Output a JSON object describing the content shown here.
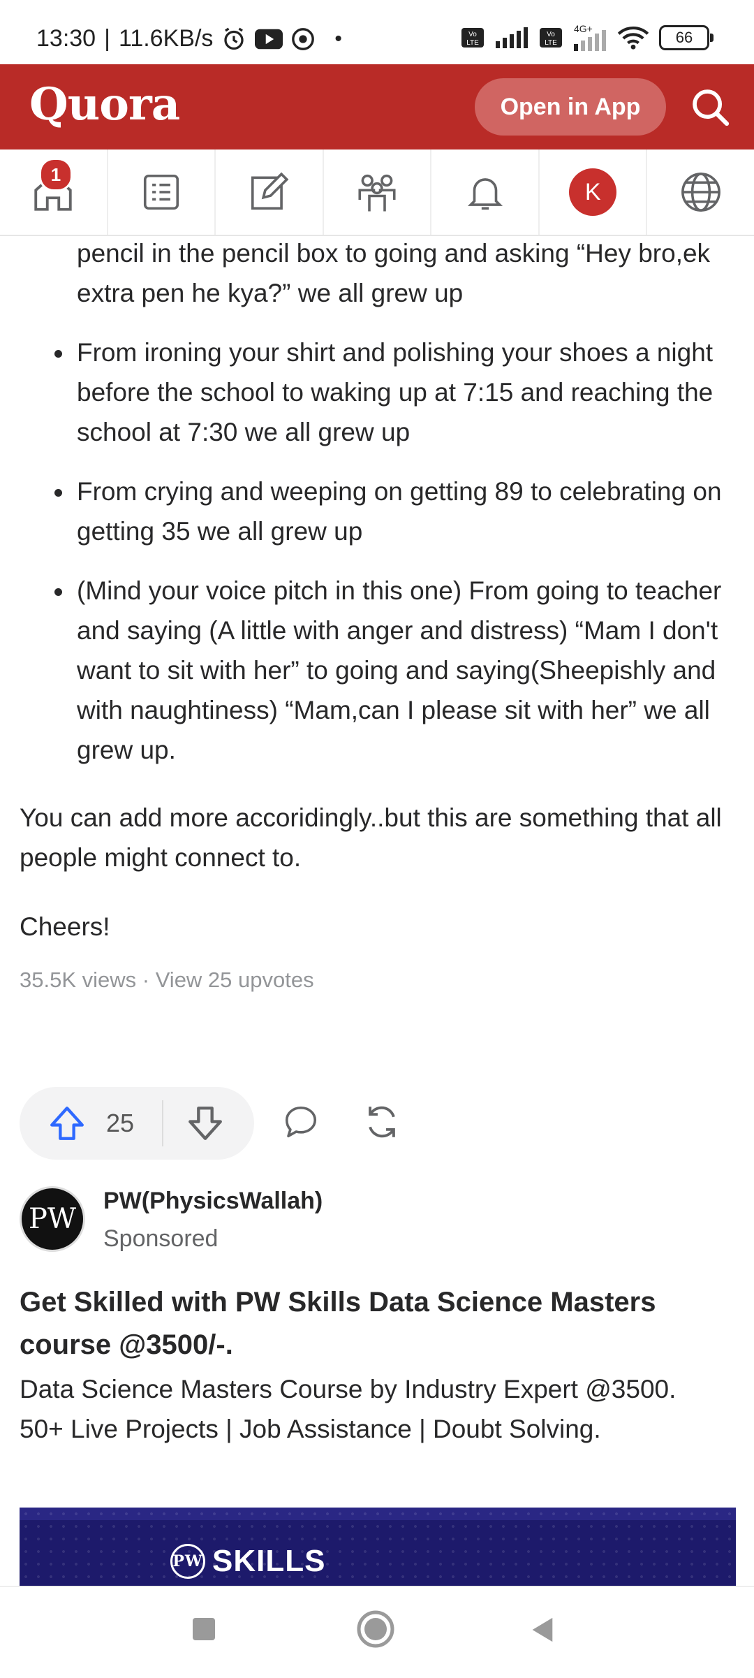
{
  "status_bar": {
    "time": "13:30",
    "speed": "11.6KB/s",
    "network_label": "4G+",
    "battery": "66"
  },
  "header": {
    "logo": "Quora",
    "open_in_app": "Open in App"
  },
  "nav": {
    "home_badge": "1",
    "avatar_letter": "K",
    "items": [
      "home-icon",
      "answer-list-icon",
      "edit-icon",
      "spaces-icon",
      "notifications-icon",
      "profile",
      "language-globe-icon"
    ]
  },
  "answer": {
    "bullet_continuation": "pencil in the pencil box to going and asking “Hey bro,ek extra pen he kya?” we all grew up",
    "bullets": [
      "From ironing your shirt and polishing your shoes a night before the school to waking up at 7:15 and reaching the school at 7:30 we all grew up",
      "From crying and weeping on getting 89 to celebrating on getting 35 we all grew up",
      "(Mind your voice pitch in this one) From going to teacher and saying (A little with anger and distress) “Mam I don't want to sit with her” to going and saying(Sheepishly and with naughtiness) “Mam,can I please sit with her” we all grew up."
    ],
    "closing": "You can add more accoridingly..but this are something that all people might connect to.",
    "signoff": "Cheers!",
    "meta": "35.5K views · View 25 upvotes",
    "upvotes": "25"
  },
  "sponsored": {
    "name": "PW(PhysicsWallah)",
    "tag": "Sponsored",
    "logo_text": "PW",
    "title": "Get Skilled with PW Skills Data Science Masters course @3500/-.",
    "description": "Data Science Masters Course by Industry Expert @3500. 50+ Live Projects | Job Assistance | Doubt Solving.",
    "banner_text": "SKILLS",
    "banner_logo_text": "PW"
  },
  "colors": {
    "brand": "#b92b27",
    "upvote_blue": "#2e69ff",
    "text": "#282829",
    "muted": "#939598"
  }
}
